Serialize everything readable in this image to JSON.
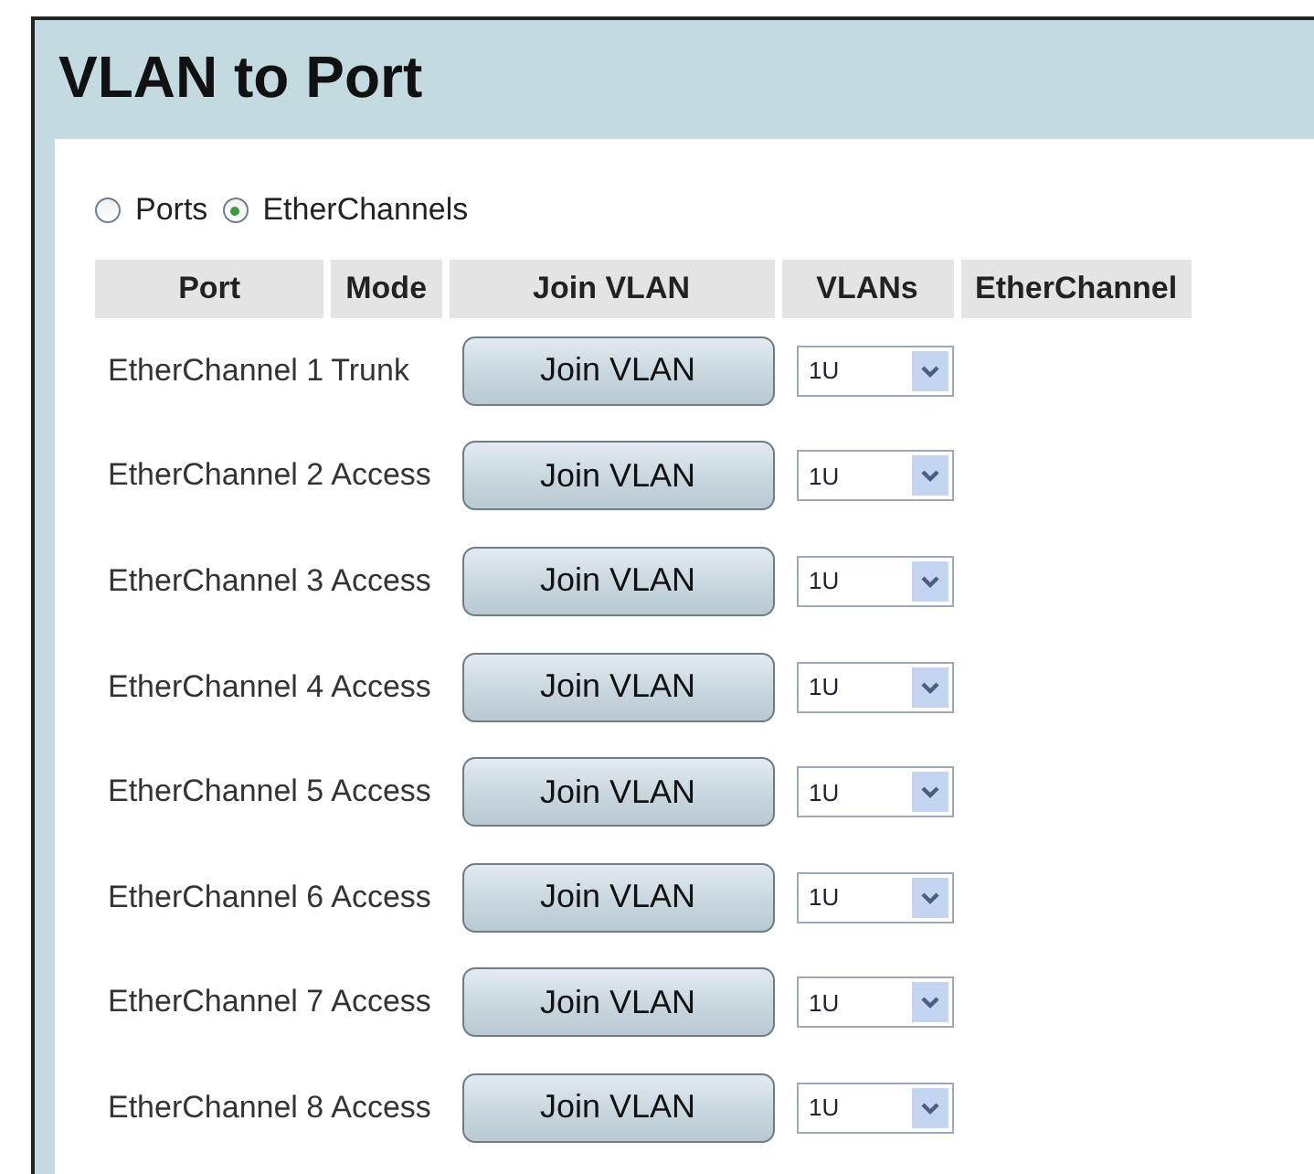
{
  "title": "VLAN to Port",
  "view_options": [
    {
      "label": "Ports",
      "selected": false
    },
    {
      "label": "EtherChannels",
      "selected": true
    }
  ],
  "table": {
    "columns": [
      "Port",
      "Mode",
      "Join VLAN",
      "VLANs",
      "EtherChannel"
    ],
    "rows": [
      {
        "port": "EtherChannel 1",
        "mode": "Trunk",
        "button": "Join VLAN",
        "vlans": "1U"
      },
      {
        "port": "EtherChannel 2",
        "mode": "Access",
        "button": "Join VLAN",
        "vlans": "1U"
      },
      {
        "port": "EtherChannel 3",
        "mode": "Access",
        "button": "Join VLAN",
        "vlans": "1U"
      },
      {
        "port": "EtherChannel 4",
        "mode": "Access",
        "button": "Join VLAN",
        "vlans": "1U"
      },
      {
        "port": "EtherChannel 5",
        "mode": "Access",
        "button": "Join VLAN",
        "vlans": "1U"
      },
      {
        "port": "EtherChannel 6",
        "mode": "Access",
        "button": "Join VLAN",
        "vlans": "1U"
      },
      {
        "port": "EtherChannel 7",
        "mode": "Access",
        "button": "Join VLAN",
        "vlans": "1U"
      },
      {
        "port": "EtherChannel 8",
        "mode": "Access",
        "button": "Join VLAN",
        "vlans": "1U"
      }
    ]
  }
}
